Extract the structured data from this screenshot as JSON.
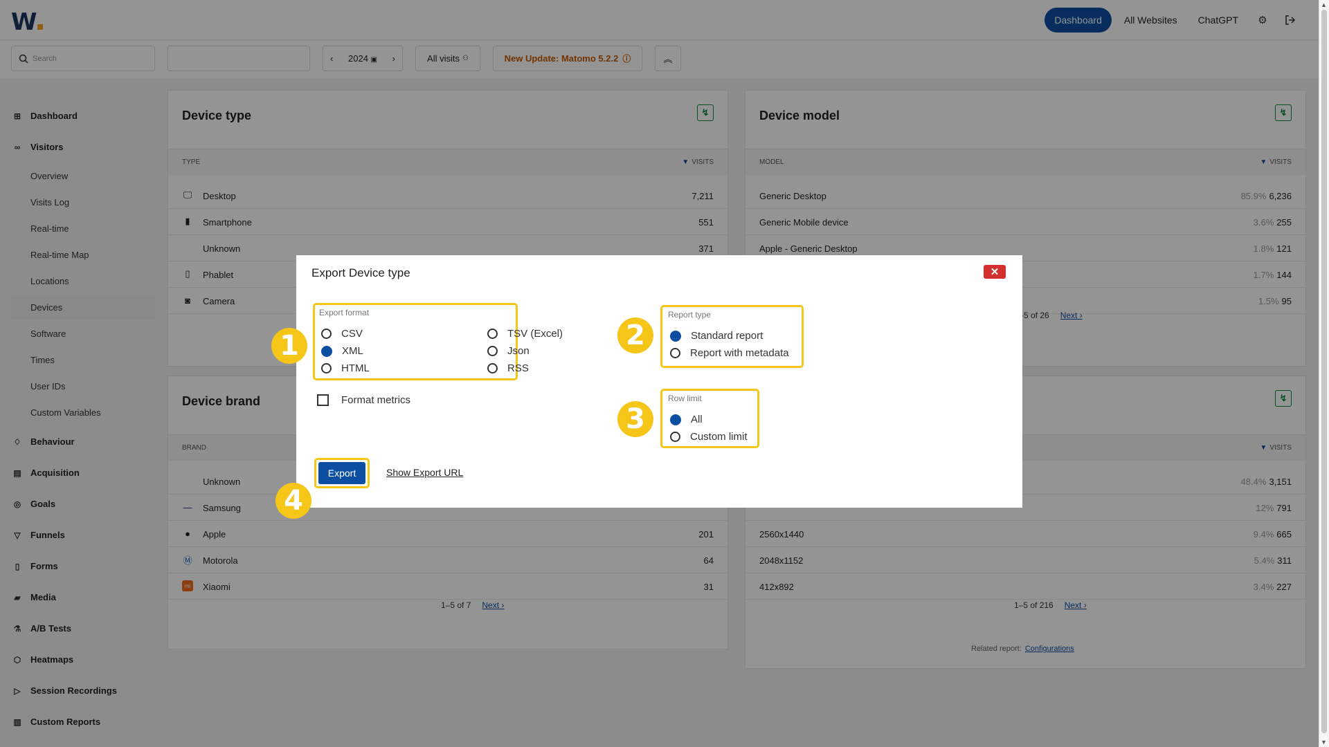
{
  "header": {
    "nav": {
      "dashboard": "Dashboard",
      "all_websites": "All Websites",
      "chatgpt": "ChatGPT"
    },
    "icons": [
      "gear-icon",
      "logout-icon"
    ]
  },
  "filters": {
    "search_placeholder": "Search",
    "period": "2024",
    "segment": "All visits",
    "update_notice": "New Update: Matomo 5.2.2"
  },
  "sidebar": {
    "items": [
      {
        "label": "Dashboard",
        "icon": "grid-icon"
      },
      {
        "label": "Visitors",
        "icon": "visitors-icon"
      },
      {
        "label": "Overview"
      },
      {
        "label": "Visits Log"
      },
      {
        "label": "Real-time"
      },
      {
        "label": "Real-time Map"
      },
      {
        "label": "Locations"
      },
      {
        "label": "Devices"
      },
      {
        "label": "Software"
      },
      {
        "label": "Times"
      },
      {
        "label": "User IDs"
      },
      {
        "label": "Custom Variables"
      },
      {
        "label": "Behaviour",
        "icon": "bell-icon"
      },
      {
        "label": "Acquisition",
        "icon": "acquisition-icon"
      },
      {
        "label": "Goals",
        "icon": "target-icon"
      },
      {
        "label": "Funnels",
        "icon": "funnel-icon"
      },
      {
        "label": "Forms",
        "icon": "forms-icon"
      },
      {
        "label": "Media",
        "icon": "media-icon"
      },
      {
        "label": "A/B Tests",
        "icon": "flask-icon"
      },
      {
        "label": "Heatmaps",
        "icon": "heatmap-icon"
      },
      {
        "label": "Session Recordings",
        "icon": "play-icon"
      },
      {
        "label": "Custom Reports",
        "icon": "reports-icon"
      }
    ]
  },
  "device_type": {
    "title": "Device type",
    "col_label": "TYPE",
    "col_value": "VISITS",
    "rows": [
      {
        "label": "Desktop",
        "value": "7,211",
        "icon": "desktop-icon"
      },
      {
        "label": "Smartphone",
        "value": "551",
        "icon": "smartphone-icon"
      },
      {
        "label": "Unknown",
        "value": "371",
        "icon": ""
      },
      {
        "label": "Phablet",
        "value": "",
        "icon": "phablet-icon"
      },
      {
        "label": "Camera",
        "value": "",
        "icon": "camera-icon"
      }
    ]
  },
  "device_model": {
    "title": "Device model",
    "col_label": "MODEL",
    "col_value": "VISITS",
    "rows": [
      {
        "label": "Generic Desktop",
        "pct": "85.9%",
        "value": "6,236"
      },
      {
        "label": "Generic Mobile device",
        "pct": "3.6%",
        "value": "255"
      },
      {
        "label": "Apple - Generic Desktop",
        "pct": "1.8%",
        "value": "121"
      },
      {
        "label": "",
        "pct": "1.7%",
        "value": "144"
      },
      {
        "label": "",
        "pct": "1.5%",
        "value": "95"
      }
    ],
    "pager_range": "-5 of 26",
    "pager_next": "Next ›"
  },
  "device_brand": {
    "title": "Device brand",
    "col_label": "BRAND",
    "rows": [
      {
        "label": "Unknown",
        "value": "",
        "icon": ""
      },
      {
        "label": "Samsung",
        "value": "",
        "icon": "samsung-icon"
      },
      {
        "label": "Apple",
        "value": "201",
        "icon": "apple-icon"
      },
      {
        "label": "Motorola",
        "value": "64",
        "icon": "motorola-icon"
      },
      {
        "label": "Xiaomi",
        "value": "31",
        "icon": "xiaomi-icon"
      }
    ],
    "pager_range": "1–5 of 7",
    "pager_next": "Next ›"
  },
  "screen_resolution": {
    "col_value": "VISITS",
    "rows": [
      {
        "label": "",
        "pct": "48.4%",
        "value": "3,151"
      },
      {
        "label": "",
        "pct": "12%",
        "value": "791"
      },
      {
        "label": "2560x1440",
        "pct": "9.4%",
        "value": "665"
      },
      {
        "label": "2048x1152",
        "pct": "5.4%",
        "value": "311"
      },
      {
        "label": "412x892",
        "pct": "3.4%",
        "value": "227"
      }
    ],
    "pager_range": "1–5 of 216",
    "pager_next": "Next ›",
    "related_label": "Related report:",
    "related_link": "Configurations"
  },
  "modal": {
    "title": "Export Device type",
    "export_format_label": "Export format",
    "formats": [
      "CSV",
      "XML",
      "HTML",
      "TSV (Excel)",
      "Json",
      "RSS"
    ],
    "selected_format": "XML",
    "format_metrics": "Format metrics",
    "report_type_label": "Report type",
    "report_types": [
      "Standard report",
      "Report with metadata"
    ],
    "selected_report_type": "Standard report",
    "row_limit_label": "Row limit",
    "row_limits": [
      "All",
      "Custom limit"
    ],
    "selected_row_limit": "All",
    "export_button": "Export",
    "export_url_link": "Show Export URL",
    "badges": [
      "1",
      "2",
      "3",
      "4"
    ],
    "highlight_color": "#f5c518"
  },
  "colors": {
    "accent": "#0b4ea2",
    "update": "#c55a00",
    "close": "#d32f2f"
  }
}
